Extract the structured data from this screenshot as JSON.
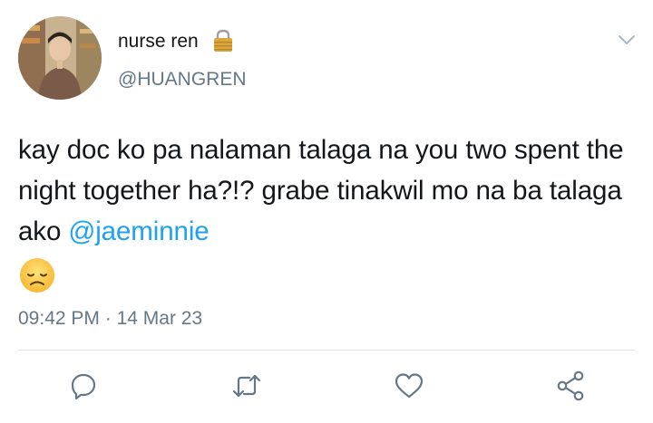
{
  "user": {
    "display_name": "nurse ren",
    "handle": "@HUANGREN",
    "locked": true
  },
  "tweet": {
    "text_before_mention": "kay doc ko pa nalaman talaga na you two spent the night together ha?!? grabe tinakwil mo na ba talaga ako ",
    "mention": "@jaeminnie",
    "emoji": "disappointed-face",
    "time": "09:42 PM",
    "separator": "·",
    "date": "14 Mar 23"
  },
  "actions": [
    "reply-icon",
    "retweet-icon",
    "like-icon",
    "share-icon"
  ],
  "colors": {
    "text": "#14171a",
    "secondary": "#657786",
    "mention": "#1da1f2",
    "divider": "#e1e8ed"
  }
}
